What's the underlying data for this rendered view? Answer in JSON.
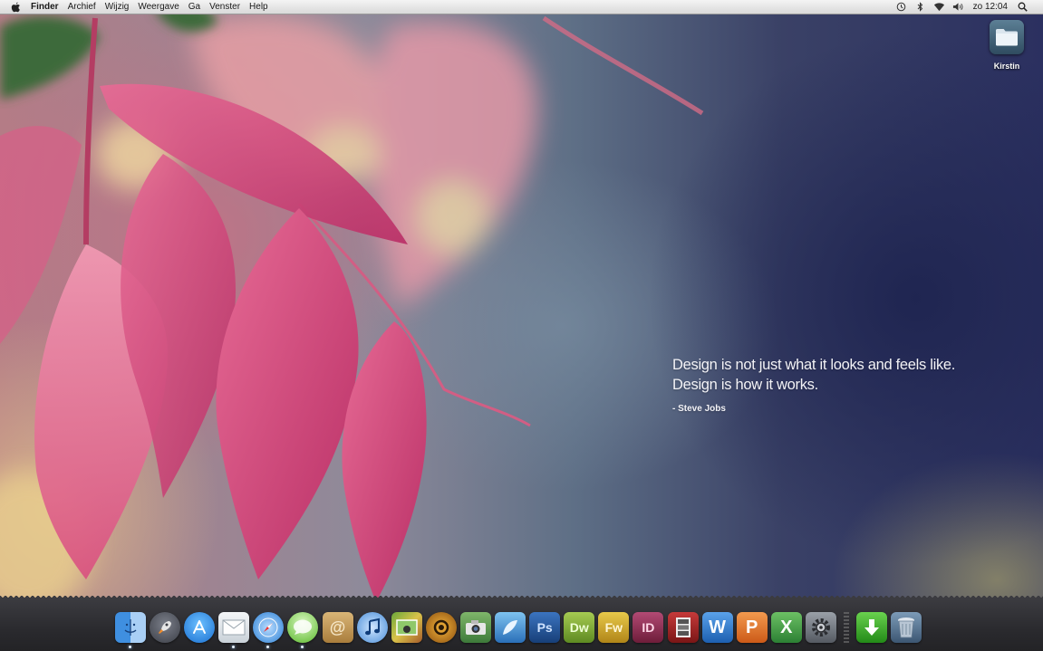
{
  "menubar": {
    "app_name": "Finder",
    "menus": [
      "Archief",
      "Wijzig",
      "Weergave",
      "Ga",
      "Venster",
      "Help"
    ],
    "status_icons": [
      "time-machine-icon",
      "bluetooth-icon",
      "wifi-icon",
      "volume-icon"
    ],
    "clock": "zo 12:04",
    "spotlight_icon": "spotlight-search-icon"
  },
  "desktop": {
    "folder_label": "Kirstin"
  },
  "wallpaper_quote": {
    "line1": "Design is not just what it looks and feels like.",
    "line2": "Design is how it works.",
    "author": "- Steve Jobs"
  },
  "dock": {
    "apps": [
      {
        "name": "finder",
        "running": true
      },
      {
        "name": "launchpad",
        "running": false
      },
      {
        "name": "app-store",
        "running": false
      },
      {
        "name": "mail",
        "running": true
      },
      {
        "name": "safari",
        "running": true
      },
      {
        "name": "messages",
        "running": true
      },
      {
        "name": "address-book",
        "running": false
      },
      {
        "name": "itunes",
        "running": false
      },
      {
        "name": "iphoto",
        "running": false
      },
      {
        "name": "transmit",
        "running": false
      },
      {
        "name": "image-capture",
        "running": false
      },
      {
        "name": "coda",
        "running": false
      },
      {
        "name": "photoshop",
        "label": "Ps",
        "running": false
      },
      {
        "name": "dreamweaver",
        "label": "Dw",
        "running": false
      },
      {
        "name": "fireworks",
        "label": "Fw",
        "running": false
      },
      {
        "name": "indesign",
        "label": "ID",
        "running": false
      },
      {
        "name": "photo-booth",
        "running": false
      },
      {
        "name": "word",
        "label": "W",
        "running": false
      },
      {
        "name": "powerpoint",
        "label": "P",
        "running": false
      },
      {
        "name": "excel",
        "label": "X",
        "running": false
      },
      {
        "name": "system-preferences",
        "running": false
      }
    ],
    "stacks": [
      {
        "name": "downloads"
      },
      {
        "name": "trash"
      }
    ]
  },
  "colors": {
    "photoshop": "#1f4e8c",
    "dreamweaver": "#7ea33a",
    "fireworks": "#c9a22a",
    "indesign": "#8b2a4c",
    "word": "#2e79c8",
    "powerpoint": "#e0702a",
    "excel": "#3c9a45",
    "downloads": "#3fae2e"
  }
}
